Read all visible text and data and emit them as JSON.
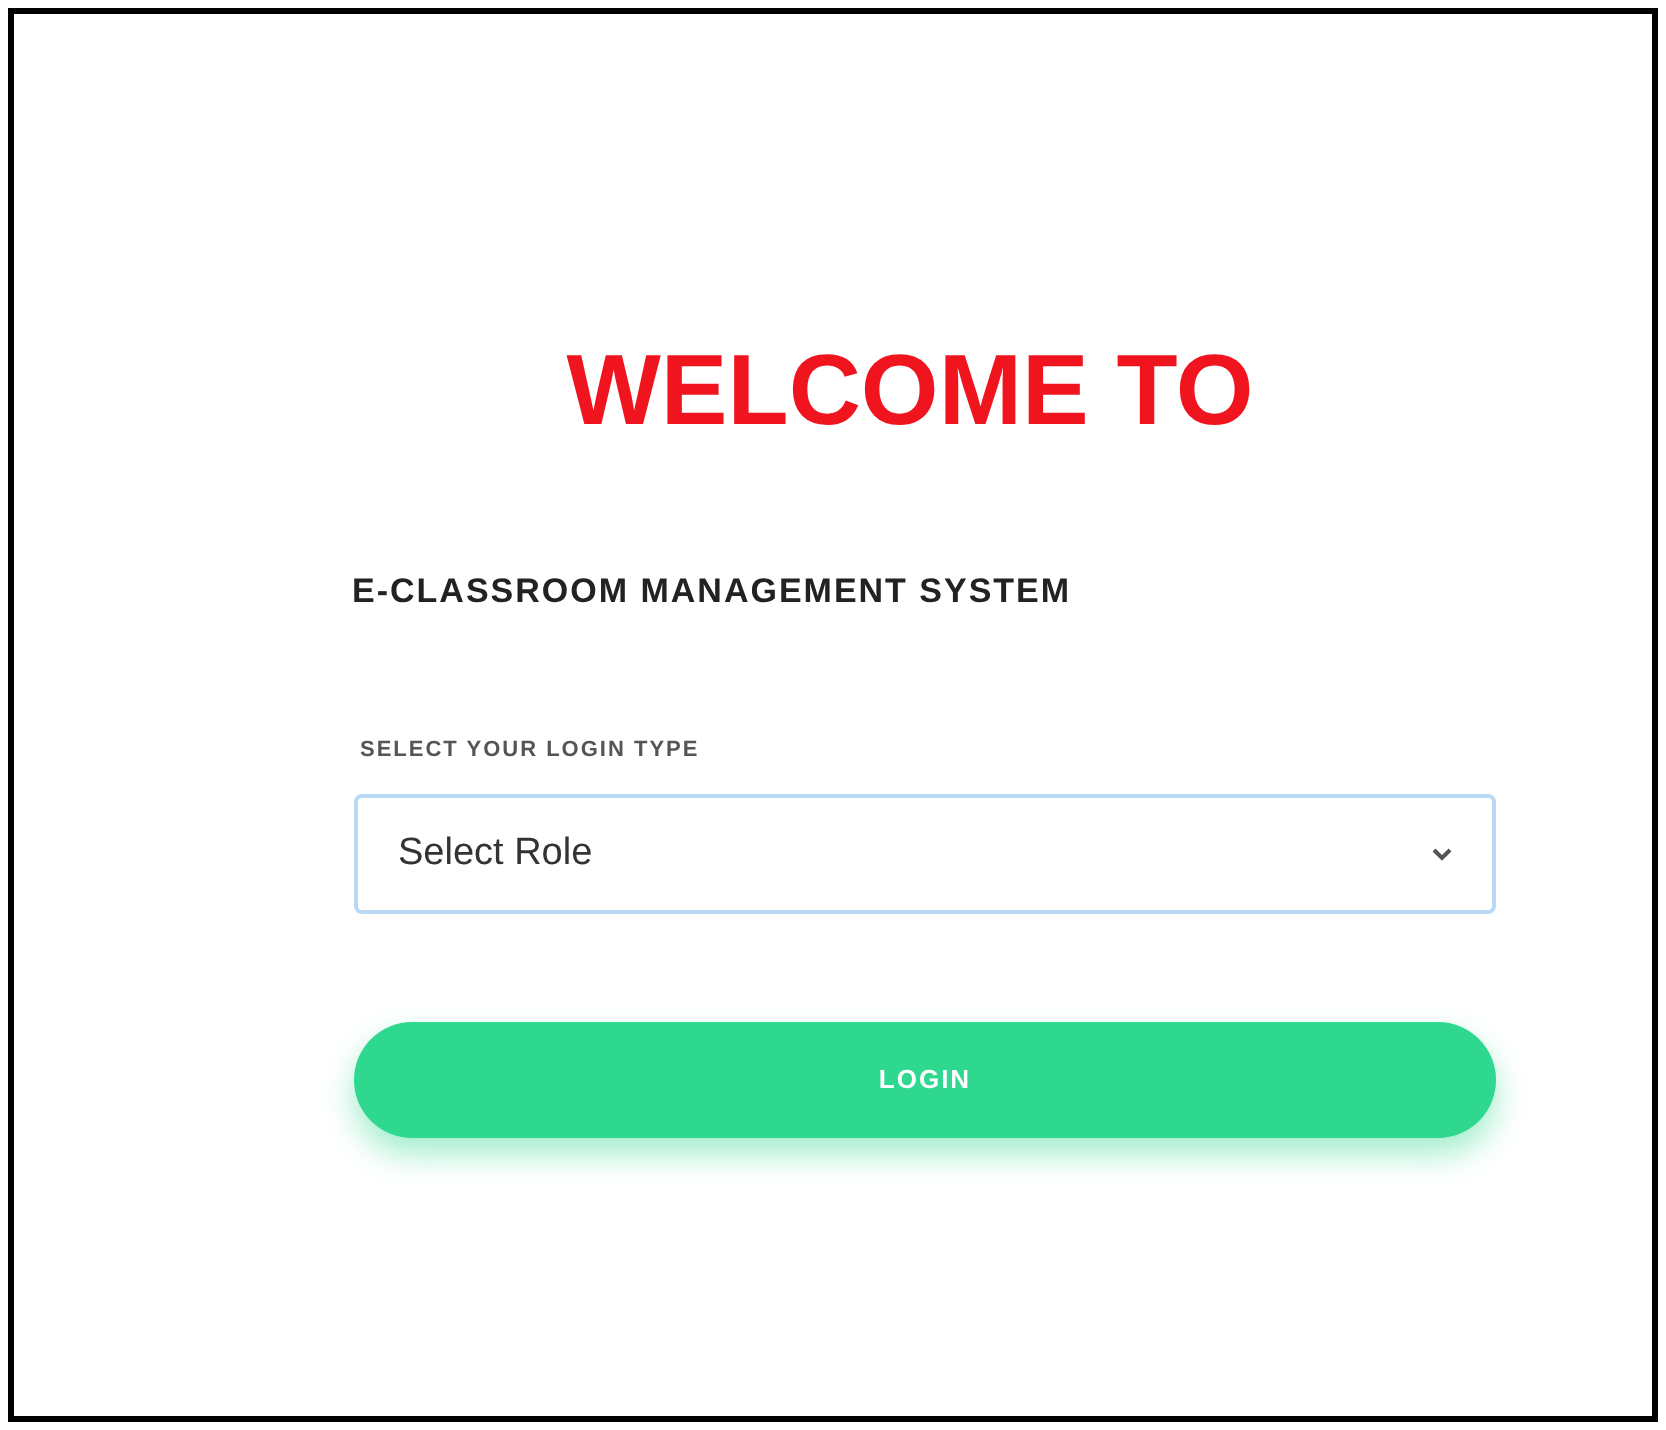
{
  "heading": "WELCOME TO",
  "subtitle": "E-CLASSROOM MANAGEMENT SYSTEM",
  "role_field": {
    "label": "SELECT YOUR LOGIN TYPE",
    "value": "Select Role"
  },
  "login_button": {
    "label": "LOGIN"
  }
}
